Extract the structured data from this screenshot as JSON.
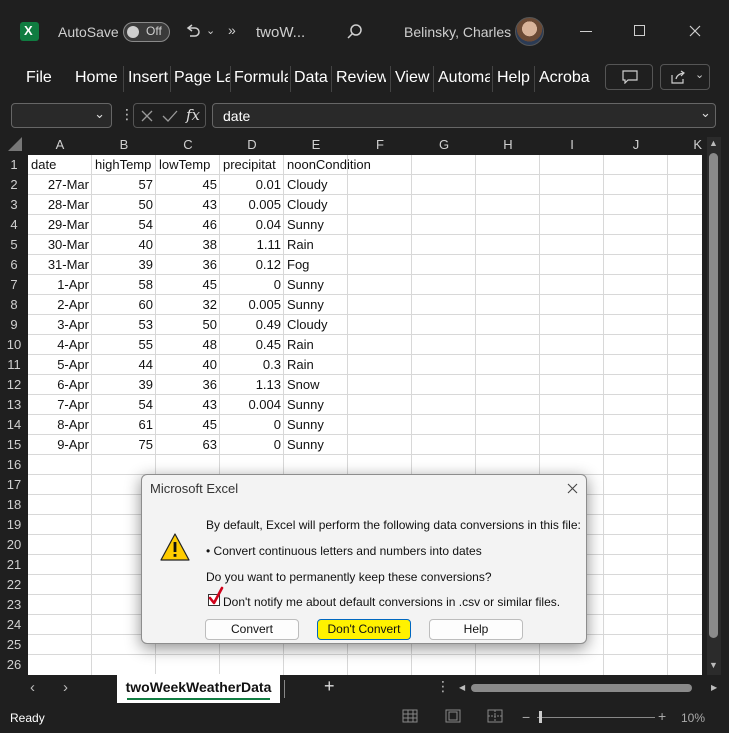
{
  "titlebar": {
    "autosave_label": "AutoSave",
    "autosave_state": "Off",
    "filename": "twoW...",
    "user": "Belinsky, Charles"
  },
  "menu": [
    "File",
    "Home",
    "Insert",
    "Page La",
    "Formula",
    "Data",
    "Review",
    "View",
    "Automa",
    "Help",
    "Acroba"
  ],
  "formula_bar": {
    "name_box": "",
    "formula": "date"
  },
  "columns": [
    "A",
    "B",
    "C",
    "D",
    "E",
    "F",
    "G",
    "H",
    "I",
    "J",
    "K"
  ],
  "sheet": {
    "header": [
      "date",
      "highTemp",
      "lowTemp",
      "precipitat",
      "noonCondition"
    ],
    "rows": [
      [
        "27-Mar",
        "57",
        "45",
        "0.01",
        "Cloudy"
      ],
      [
        "28-Mar",
        "50",
        "43",
        "0.005",
        "Cloudy"
      ],
      [
        "29-Mar",
        "54",
        "46",
        "0.04",
        "Sunny"
      ],
      [
        "30-Mar",
        "40",
        "38",
        "1.11",
        "Rain"
      ],
      [
        "31-Mar",
        "39",
        "36",
        "0.12",
        "Fog"
      ],
      [
        "1-Apr",
        "58",
        "45",
        "0",
        "Sunny"
      ],
      [
        "2-Apr",
        "60",
        "32",
        "0.005",
        "Sunny"
      ],
      [
        "3-Apr",
        "53",
        "50",
        "0.49",
        "Cloudy"
      ],
      [
        "4-Apr",
        "55",
        "48",
        "0.45",
        "Rain"
      ],
      [
        "5-Apr",
        "44",
        "40",
        "0.3",
        "Rain"
      ],
      [
        "6-Apr",
        "39",
        "36",
        "1.13",
        "Snow"
      ],
      [
        "7-Apr",
        "54",
        "43",
        "0.004",
        "Sunny"
      ],
      [
        "8-Apr",
        "61",
        "45",
        "0",
        "Sunny"
      ],
      [
        "9-Apr",
        "75",
        "63",
        "0",
        "Sunny"
      ]
    ],
    "row_numbers": [
      "1",
      "2",
      "3",
      "4",
      "5",
      "6",
      "7",
      "8",
      "9",
      "10",
      "11",
      "12",
      "13",
      "14",
      "15",
      "16",
      "17",
      "18",
      "19",
      "20",
      "21",
      "22",
      "23",
      "24",
      "25",
      "26"
    ]
  },
  "dialog": {
    "title": "Microsoft Excel",
    "line1": "By default, Excel will perform the following data conversions in this file:",
    "bullet": "• Convert continuous letters and numbers into dates",
    "question": "Do you want to permanently keep these conversions?",
    "checkbox_label": "Don't notify me about default conversions in .csv or similar files.",
    "buttons": {
      "convert": "Convert",
      "dont_convert": "Don't Convert",
      "help": "Help"
    }
  },
  "tabs": {
    "sheet_name": "twoWeekWeatherData"
  },
  "status": {
    "text": "Ready",
    "zoom": "10%"
  },
  "colors": {
    "excel_green": "#107c41",
    "highlight": "#fff200",
    "checkmark": "#d0021b"
  },
  "icons": [
    "excel-logo-icon",
    "undo-icon",
    "search-icon",
    "minimize-icon",
    "maximize-icon",
    "close-icon",
    "comment-icon",
    "share-icon",
    "fx-icon",
    "warning-icon"
  ]
}
